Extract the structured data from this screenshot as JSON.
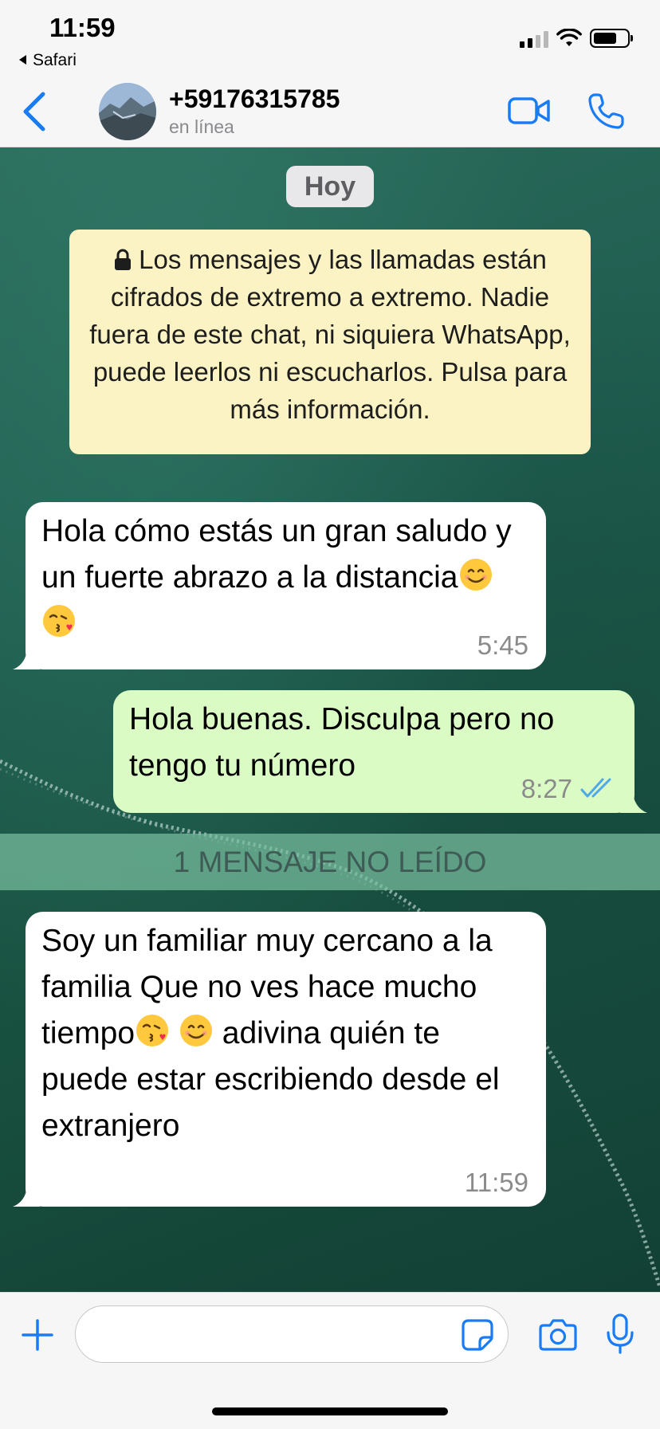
{
  "status_bar": {
    "time": "11:59",
    "back_app": "Safari",
    "battery_level": 0.7,
    "signal_bars": 2
  },
  "header": {
    "contact_name": "+59176315785",
    "contact_status": "en línea",
    "icons": {
      "back": "chevron-left-icon",
      "video": "video-camera-icon",
      "call": "phone-icon"
    },
    "accent_color": "#1a7cf5"
  },
  "chat": {
    "date_label": "Hoy",
    "encryption_notice": "Los mensajes y las llamadas están cifrados de extremo a extremo. Nadie fuera de este chat, ni siquiera WhatsApp, puede leerlos ni escucharlos. Pulsa para más información.",
    "messages": [
      {
        "direction": "incoming",
        "text": "Hola cómo estás un gran saludo y un fuerte abrazo a la distancia",
        "emojis": [
          "smiling-face-icon",
          "face-blowing-kiss-icon"
        ],
        "time": "5:45"
      },
      {
        "direction": "outgoing",
        "text": "Hola buenas. Disculpa pero no tengo tu número",
        "time": "8:27",
        "read": true
      },
      {
        "direction": "incoming",
        "text_before": "Soy un familiar muy cercano a la familia Que no ves hace mucho tiempo",
        "text_after": "adivina quién te puede estar escribiendo desde el extranjero",
        "emojis": [
          "face-blowing-kiss-icon",
          "smiling-face-icon"
        ],
        "time": "11:59"
      }
    ],
    "unread_banner": "1 MENSAJE NO LEÍDO",
    "incoming_bubble_color": "#ffffff",
    "outgoing_bubble_color": "#dbfbc5",
    "notice_color": "#fbf3c4"
  },
  "input_bar": {
    "message_value": "",
    "icons": {
      "plus": "plus-icon",
      "sticker": "sticker-icon",
      "camera": "camera-icon",
      "mic": "microphone-icon"
    }
  }
}
